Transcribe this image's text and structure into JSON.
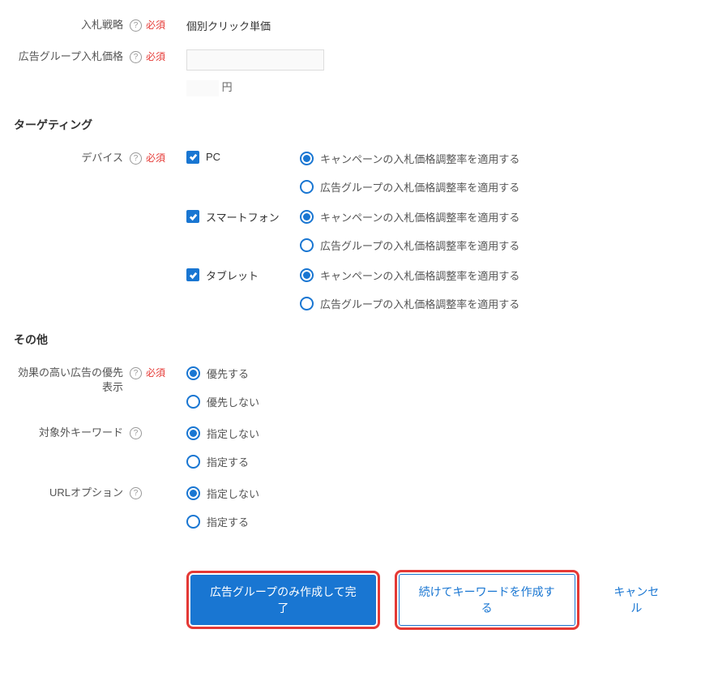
{
  "bidStrategy": {
    "label": "入札戦略",
    "required": "必須",
    "value": "個別クリック単価"
  },
  "adGroupBid": {
    "label": "広告グループ入札価格",
    "required": "必須",
    "currency": "円"
  },
  "targeting": {
    "title": "ターゲティング",
    "deviceLabel": "デバイス",
    "required": "必須",
    "devices": [
      {
        "name": "PC",
        "checked": true
      },
      {
        "name": "スマートフォン",
        "checked": true
      },
      {
        "name": "タブレット",
        "checked": true
      }
    ],
    "options": {
      "campaign": "キャンペーンの入札価格調整率を適用する",
      "adgroup": "広告グループの入札価格調整率を適用する"
    }
  },
  "other": {
    "title": "その他",
    "priorityAd": {
      "label": "効果の高い広告の優先表示",
      "required": "必須",
      "opt1": "優先する",
      "opt2": "優先しない"
    },
    "negativeKeyword": {
      "label": "対象外キーワード",
      "opt1": "指定しない",
      "opt2": "指定する"
    },
    "urlOption": {
      "label": "URLオプション",
      "opt1": "指定しない",
      "opt2": "指定する"
    }
  },
  "buttons": {
    "primary": "広告グループのみ作成して完了",
    "secondary": "続けてキーワードを作成する",
    "cancel": "キャンセル"
  },
  "helpIcon": "?"
}
